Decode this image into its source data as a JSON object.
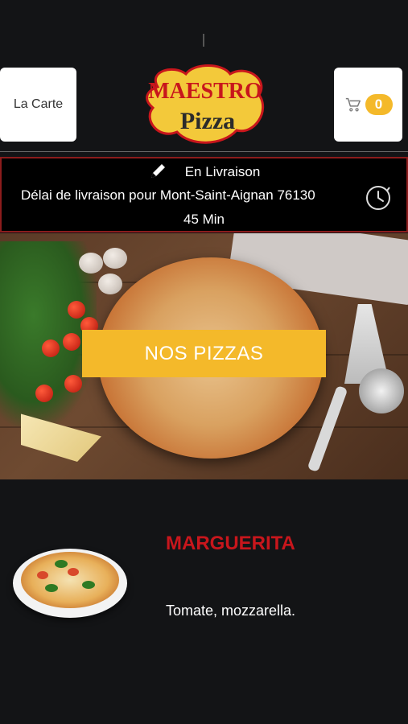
{
  "header": {
    "carte_label": "La Carte",
    "cart_count": "0",
    "logo_line1": "MAESTRO",
    "logo_line2": "Pizza"
  },
  "delivery": {
    "mode": "En Livraison",
    "delay_text": "Délai de livraison pour Mont-Saint-Aignan 76130",
    "duration": "45 Min"
  },
  "hero": {
    "button_label": "NOS PIZZAS"
  },
  "product": {
    "name": "MARGUERITA",
    "description": "Tomate, mozzarella."
  },
  "colors": {
    "accent": "#f4b92a",
    "brand_red": "#c8161c",
    "background": "#131416"
  },
  "icons": {
    "cart": "cart-icon",
    "edit": "pencil-icon",
    "time": "clock-icon"
  }
}
